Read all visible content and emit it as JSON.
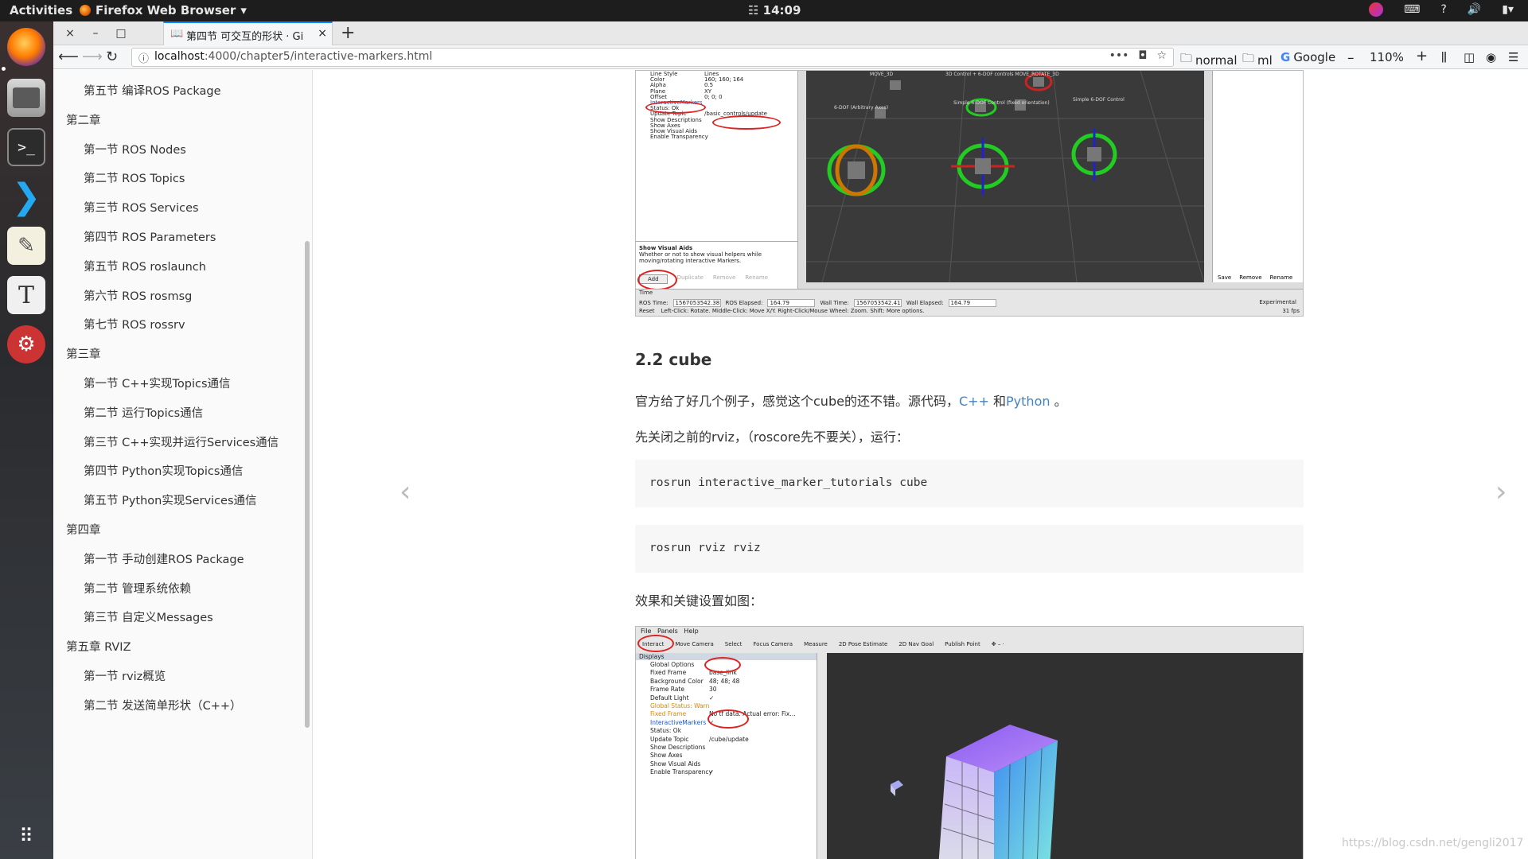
{
  "topbar": {
    "activities": "Activities",
    "app_name": "Firefox Web Browser",
    "clock": "14:09"
  },
  "browser": {
    "tab_title": "第四节 可交互的形状 · Gi",
    "url_host": "localhost",
    "url_path": ":4000/chapter5/interactive-markers.html",
    "bookmarks": [
      "normal",
      "ml",
      "Google"
    ],
    "zoom": "110%"
  },
  "sidebar": {
    "items": [
      {
        "label": "第五节 编译ROS Package",
        "level": 2
      },
      {
        "label": "第二章",
        "level": 1
      },
      {
        "label": "第一节 ROS Nodes",
        "level": 2
      },
      {
        "label": "第二节 ROS Topics",
        "level": 2
      },
      {
        "label": "第三节 ROS Services",
        "level": 2
      },
      {
        "label": "第四节 ROS Parameters",
        "level": 2
      },
      {
        "label": "第五节 ROS roslaunch",
        "level": 2
      },
      {
        "label": "第六节 ROS rosmsg",
        "level": 2
      },
      {
        "label": "第七节 ROS rossrv",
        "level": 2
      },
      {
        "label": "第三章",
        "level": 1
      },
      {
        "label": "第一节 C++实现Topics通信",
        "level": 2
      },
      {
        "label": "第二节 运行Topics通信",
        "level": 2
      },
      {
        "label": "第三节 C++实现并运行Services通信",
        "level": 2
      },
      {
        "label": "第四节 Python实现Topics通信",
        "level": 2
      },
      {
        "label": "第五节 Python实现Services通信",
        "level": 2
      },
      {
        "label": "第四章",
        "level": 1
      },
      {
        "label": "第一节 手动创建ROS Package",
        "level": 2
      },
      {
        "label": "第二节 管理系统依赖",
        "level": 2
      },
      {
        "label": "第三节 自定义Messages",
        "level": 2
      },
      {
        "label": "第五章 RVIZ",
        "level": 1
      },
      {
        "label": "第一节 rviz概览",
        "level": 2
      },
      {
        "label": "第二节 发送简单形状（C++）",
        "level": 2
      }
    ]
  },
  "content": {
    "heading": "2.2 cube",
    "para1_text": "官方给了好几个例子，感觉这个cube的还不错。源代码，",
    "para1_link_cpp": "C++",
    "para1_and": " 和",
    "para1_link_py": "Python",
    "para1_end": " 。",
    "para2": "先关闭之前的rviz，（roscore先不要关），运行：",
    "code1": "rosrun interactive_marker_tutorials cube",
    "code2": "rosrun rviz rviz",
    "para3": "效果和关键设置如图："
  },
  "shot1": {
    "props": [
      [
        "Line Style",
        "Lines"
      ],
      [
        "Color",
        "160; 160; 164"
      ],
      [
        "Alpha",
        "0.5"
      ],
      [
        "Plane",
        "XY"
      ],
      [
        "Offset",
        "0; 0; 0"
      ],
      [
        "InteractiveMarkers",
        ""
      ],
      [
        "Status: Ok",
        ""
      ],
      [
        "Update Topic",
        "/basic_controls/update"
      ],
      [
        "Show Descriptions",
        ""
      ],
      [
        "Show Axes",
        ""
      ],
      [
        "Show Visual Aids",
        ""
      ],
      [
        "Enable Transparency",
        ""
      ]
    ],
    "help_title": "Show Visual Aids",
    "help_text": "Whether or not to show visual helpers while moving/rotating interactive Markers.",
    "buttons": [
      "Add",
      "Duplicate",
      "Remove",
      "Rename"
    ],
    "right_buttons": [
      "Save",
      "Remove",
      "Rename"
    ],
    "time_label": "Time",
    "ros_time_label": "ROS Time:",
    "ros_time": "1567053542.38",
    "ros_elapsed_label": "ROS Elapsed:",
    "ros_elapsed": "164.79",
    "wall_time_label": "Wall Time:",
    "wall_time": "1567053542.41",
    "wall_elapsed_label": "Wall Elapsed:",
    "wall_elapsed": "164.79",
    "experimental": "Experimental",
    "reset": "Reset",
    "hint": "Left-Click: Rotate. Middle-Click: Move X/Y. Right-Click/Mouse Wheel: Zoom. Shift: More options.",
    "fps": "31 fps",
    "markers": [
      "MOVE_3D",
      "3D Control + 6-DOF controls MOVE_ROTATE_3D",
      "6-DOF (Arbitrary Axes)",
      "Simple 6-DOF Control (fixed orientation)",
      "Simple 6-DOF Control"
    ]
  },
  "shot2": {
    "menu": [
      "File",
      "Panels",
      "Help"
    ],
    "tools": [
      "Interact",
      "Move Camera",
      "Select",
      "Focus Camera",
      "Measure",
      "2D Pose Estimate",
      "2D Nav Goal",
      "Publish Point"
    ],
    "displays_title": "Displays",
    "props": [
      [
        "Global Options",
        ""
      ],
      [
        "Fixed Frame",
        "base_link"
      ],
      [
        "Background Color",
        "48; 48; 48"
      ],
      [
        "Frame Rate",
        "30"
      ],
      [
        "Default Light",
        "✓"
      ],
      [
        "Global Status: Warn",
        ""
      ],
      [
        "Fixed Frame",
        "No tf data.  Actual error: Fix..."
      ],
      [
        "InteractiveMarkers",
        "✓"
      ],
      [
        "Status: Ok",
        ""
      ],
      [
        "Update Topic",
        "/cube/update"
      ],
      [
        "Show Descriptions",
        ""
      ],
      [
        "Show Axes",
        ""
      ],
      [
        "Show Visual Aids",
        ""
      ],
      [
        "Enable Transparency",
        "✓"
      ]
    ]
  },
  "watermark": "https://blog.csdn.net/gengli2017",
  "colors": {
    "link": "#4183c4",
    "code_bg": "#f7f7f7",
    "annotation": "#d22222"
  }
}
